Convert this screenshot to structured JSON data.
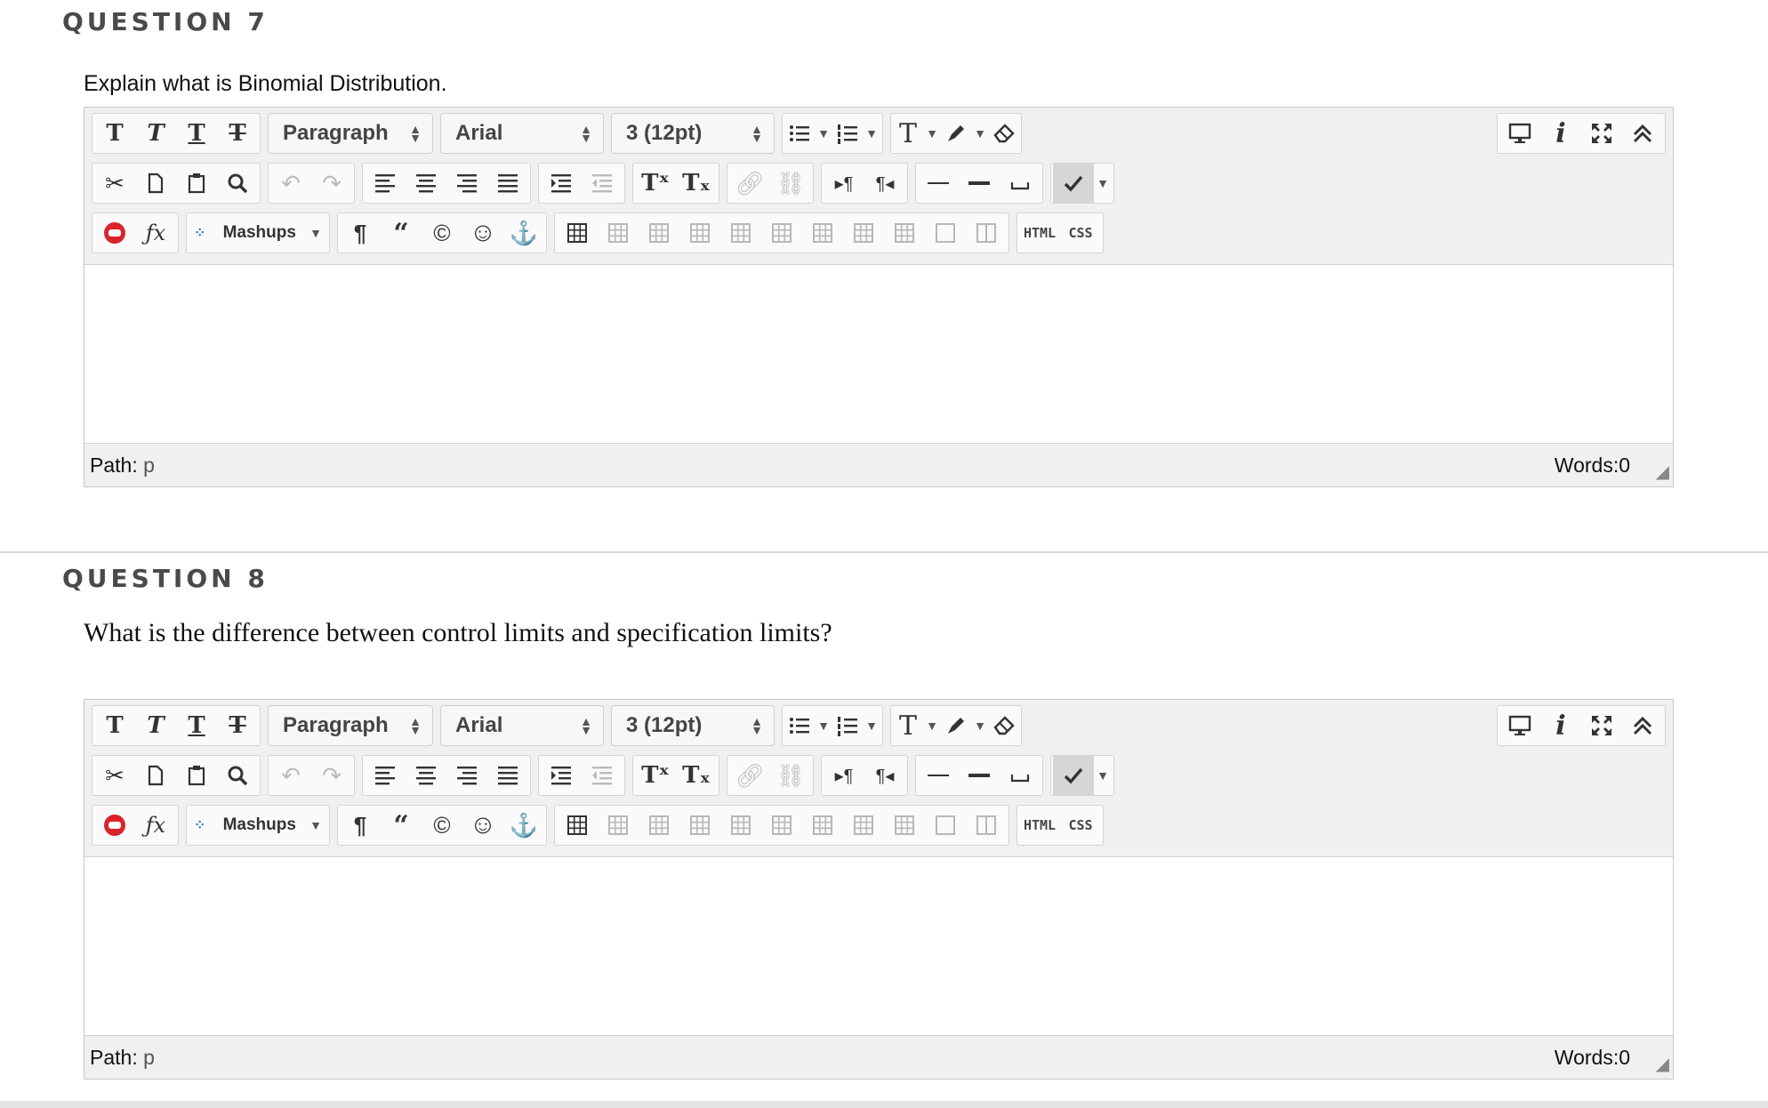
{
  "questions": [
    {
      "heading": "QUESTION 7",
      "text": "Explain what is Binomial Distribution.",
      "editor": {
        "path_label": "Path:",
        "path_value": "p",
        "words": "Words:0"
      }
    },
    {
      "heading": "QUESTION 8",
      "text": "What is the difference between control limits and specification limits?",
      "editor": {
        "path_label": "Path:",
        "path_value": "p",
        "words": "Words:0"
      }
    }
  ],
  "toolbar": {
    "format_block": "Paragraph",
    "font_family": "Arial",
    "font_size": "3 (12pt)",
    "mashups": "Mashups",
    "html": "HTML",
    "css": "CSS",
    "glyphs": {
      "bold": "T",
      "italic": "T",
      "underline": "T",
      "strike": "T",
      "superscript": "Tˣ",
      "subscript": "Tₓ",
      "pilcrow": "¶",
      "quote": "“",
      "copyright": "©",
      "anchor": "⚓",
      "emoji": "☺",
      "formula": "ƒx",
      "text_color": "T",
      "info": "i"
    }
  },
  "icons": [
    "bold-icon",
    "italic-icon",
    "underline-icon",
    "strikethrough-icon",
    "bullet-list-icon",
    "numbered-list-icon",
    "text-color-icon",
    "highlight-icon",
    "eraser-icon",
    "cut-icon",
    "copy-icon",
    "paste-icon",
    "find-icon",
    "undo-icon",
    "redo-icon",
    "align-left-icon",
    "align-center-icon",
    "align-right-icon",
    "justify-icon",
    "indent-icon",
    "outdent-icon",
    "superscript-icon",
    "subscript-icon",
    "link-icon",
    "unlink-icon",
    "ltr-icon",
    "rtl-icon",
    "hr-icon",
    "thick-hr-icon",
    "nbsp-icon",
    "spellcheck-icon",
    "youtube-icon",
    "formula-icon",
    "mashups-icon",
    "pilcrow-icon",
    "quote-icon",
    "copyright-icon",
    "emoji-icon",
    "anchor-icon",
    "table-icon",
    "preview-icon",
    "info-icon",
    "fullscreen-icon",
    "collapse-icon"
  ],
  "colors": {
    "accent_red": "#d9232d",
    "mashup_blue": "#3a7fc1",
    "toolbar_bg": "#f0f0f0"
  }
}
